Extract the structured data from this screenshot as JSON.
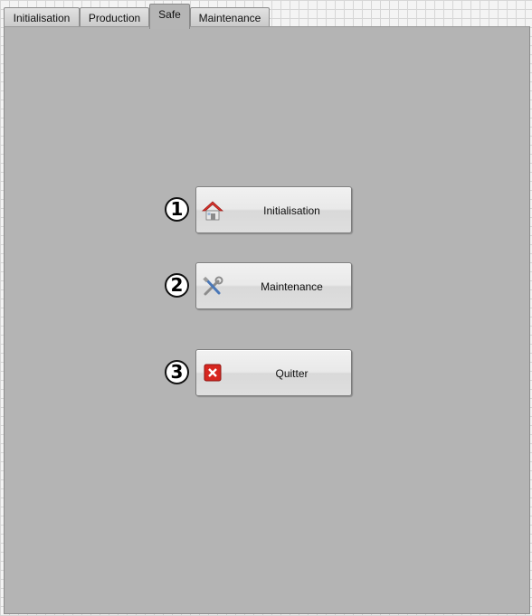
{
  "tabs": [
    {
      "label": "Initialisation",
      "active": false
    },
    {
      "label": "Production",
      "active": false
    },
    {
      "label": "Safe",
      "active": true
    },
    {
      "label": "Maintenance",
      "active": false
    }
  ],
  "actions": [
    {
      "number": "1",
      "label": "Initialisation",
      "icon": "home-icon"
    },
    {
      "number": "2",
      "label": "Maintenance",
      "icon": "tools-icon"
    },
    {
      "number": "3",
      "label": "Quitter",
      "icon": "close-icon"
    }
  ],
  "colors": {
    "panel": "#b4b4b4",
    "button": "#e9e9e9",
    "home_roof": "#d9322c",
    "close_red": "#d7261f"
  }
}
